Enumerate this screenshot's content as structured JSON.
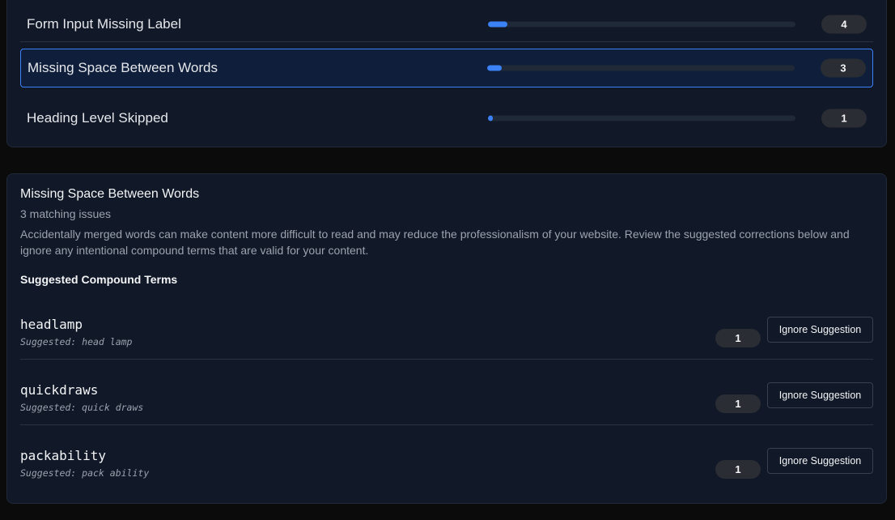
{
  "categories": [
    {
      "label": "Form Input Missing Label",
      "count": "4",
      "fraction": 0.063
    },
    {
      "label": "Missing Space Between Words",
      "count": "3",
      "fraction": 0.047
    },
    {
      "label": "Heading Level Skipped",
      "count": "1",
      "fraction": 0.016
    }
  ],
  "detail": {
    "title": "Missing Space Between Words",
    "subtitle": "3 matching issues",
    "description": "Accidentally merged words can make content more difficult to read and may reduce the professionalism of your website. Review the suggested corrections below and ignore any intentional compound terms that are valid for your content.",
    "section_heading": "Suggested Compound Terms",
    "terms": [
      {
        "word": "headlamp",
        "suggestion": "Suggested: head lamp",
        "count": "1",
        "button": "Ignore Suggestion"
      },
      {
        "word": "quickdraws",
        "suggestion": "Suggested: quick draws",
        "count": "1",
        "button": "Ignore Suggestion"
      },
      {
        "word": "packability",
        "suggestion": "Suggested: pack ability",
        "count": "1",
        "button": "Ignore Suggestion"
      }
    ]
  },
  "colors": {
    "accent": "#3b82f6",
    "panel_bg": "#111827",
    "selected_bg": "#0f1e3a"
  }
}
